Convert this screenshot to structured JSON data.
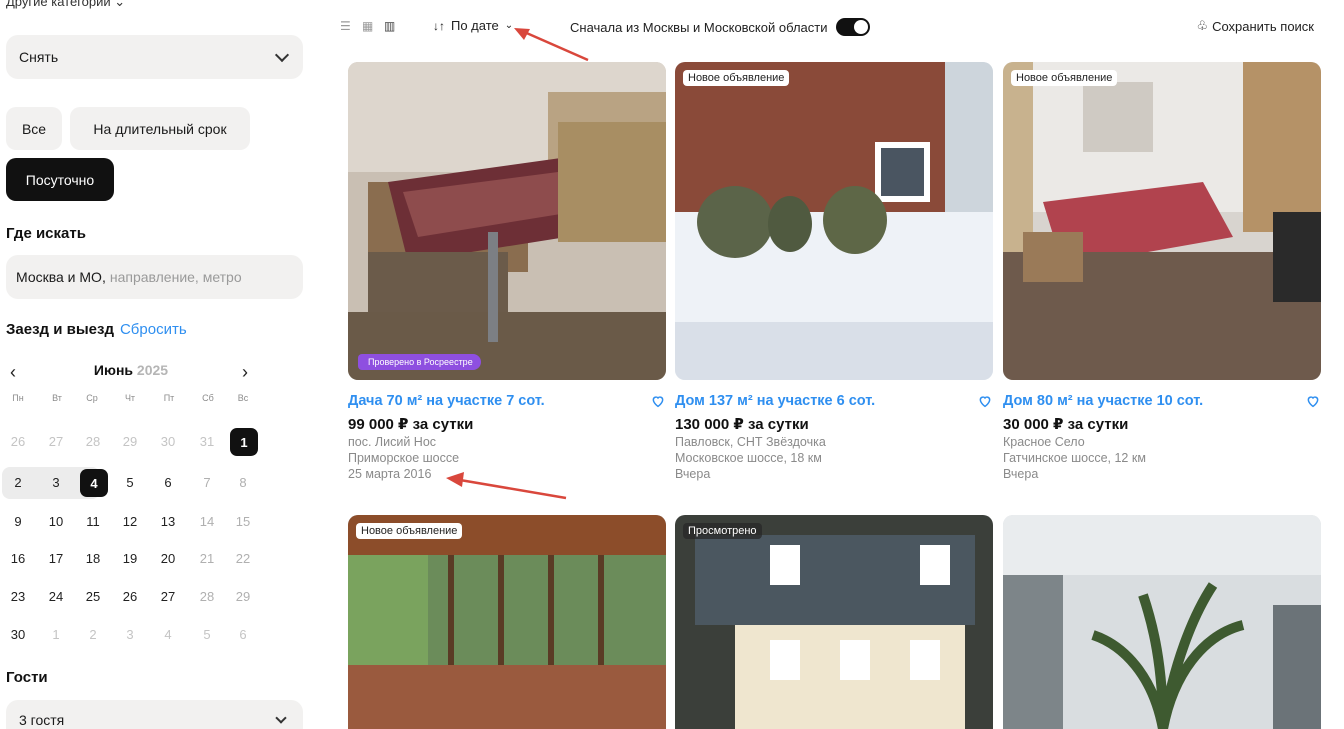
{
  "sidebar": {
    "other_categories": "Другие категории ⌄",
    "deal_type": "Снять",
    "period_chips": [
      "Все",
      "На длительный срок",
      "Посуточно"
    ],
    "where_heading": "Где искать",
    "where_value": "Москва и МО,",
    "where_placeholder": "направление, метро",
    "dates_heading": "Заезд и выезд",
    "reset_label": "Сбросить",
    "calendar": {
      "month": "Июнь",
      "year": "2025",
      "weekdays": [
        "Пн",
        "Вт",
        "Ср",
        "Чт",
        "Пт",
        "Сб",
        "Вс"
      ],
      "weeks": [
        [
          "26",
          "27",
          "28",
          "29",
          "30",
          "31",
          "1"
        ],
        [
          "2",
          "3",
          "4",
          "5",
          "6",
          "7",
          "8"
        ],
        [
          "9",
          "10",
          "11",
          "12",
          "13",
          "14",
          "15"
        ],
        [
          "16",
          "17",
          "18",
          "19",
          "20",
          "21",
          "22"
        ],
        [
          "23",
          "24",
          "25",
          "26",
          "27",
          "28",
          "29"
        ],
        [
          "30",
          "1",
          "2",
          "3",
          "4",
          "5",
          "6"
        ]
      ]
    },
    "guests_heading": "Гости",
    "guests_value": "3 гостя"
  },
  "toolbar": {
    "sort_label": "По дате",
    "moscow_first_label": "Сначала из Москвы и Московской области",
    "save_search_label": "Сохранить поиск"
  },
  "cards": [
    {
      "title": "Дача 70 м² на участке 7 сот.",
      "price": "99 000 ₽ за сутки",
      "line1": "пос. Лисий Нос",
      "line2": "Приморское шоссе",
      "date": "25 марта 2016",
      "badge": "",
      "verified": "Проверено в Росреестре"
    },
    {
      "title": "Дом 137 м² на участке 6 сот.",
      "price": "130 000 ₽ за сутки",
      "line1": "Павловск, СНТ Звёздочка",
      "line2": "Московское шоссе, 18 км",
      "date": "Вчера",
      "badge": "Новое объявление",
      "verified": ""
    },
    {
      "title": "Дом 80 м² на участке 10 сот.",
      "price": "30 000 ₽ за сутки",
      "line1": "Красное Село",
      "line2": "Гатчинское шоссе, 12 км",
      "date": "Вчера",
      "badge": "Новое объявление",
      "verified": ""
    },
    {
      "badge": "Новое объявление"
    },
    {
      "badge": "Просмотрено"
    },
    {
      "badge": ""
    }
  ],
  "colors": {
    "accent": "#2f8ff0",
    "annotation_arrow": "#d9473c",
    "verified": "#8e4fe0"
  }
}
